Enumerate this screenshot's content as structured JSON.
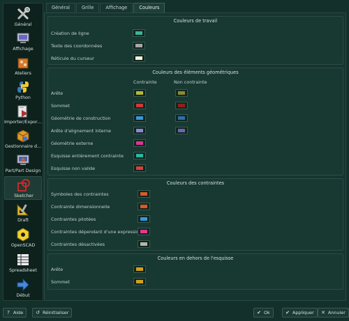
{
  "sidebar": {
    "items": [
      {
        "label": "Général",
        "icon": "tools-icon"
      },
      {
        "label": "Affichage",
        "icon": "monitor-icon"
      },
      {
        "label": "Ateliers",
        "icon": "workbench-icon"
      },
      {
        "label": "Python",
        "icon": "python-icon"
      },
      {
        "label": "Importer/Exporter",
        "icon": "import-export-icon"
      },
      {
        "label": "Gestionnaire d...",
        "icon": "addon-manager-icon"
      },
      {
        "label": "Part/Part Design",
        "icon": "part-design-icon"
      },
      {
        "label": "Sketcher",
        "icon": "sketcher-icon"
      },
      {
        "label": "Draft",
        "icon": "draft-icon"
      },
      {
        "label": "OpenSCAD",
        "icon": "openscad-icon"
      },
      {
        "label": "Spreadsheet",
        "icon": "spreadsheet-icon"
      },
      {
        "label": "Début",
        "icon": "start-arrow-icon"
      }
    ],
    "active": "Sketcher"
  },
  "tabs": [
    "Général",
    "Grille",
    "Affichage",
    "Couleurs"
  ],
  "active_tab": "Couleurs",
  "work_colors": {
    "title": "Couleurs de travail",
    "rows": [
      {
        "label": "Création de ligne",
        "color": "#3bb39a"
      },
      {
        "label": "Texte des coordonnées",
        "color": "#a8a8a8"
      },
      {
        "label": "Réticule du curseur",
        "color": "#f2f2dc"
      }
    ]
  },
  "geometry_colors": {
    "title": "Couleurs des éléments géométriques",
    "col_constrained": "Contrainte",
    "col_unconstrained": "Non contrainte",
    "rows": [
      {
        "label": "Arête",
        "color": "#b8b838",
        "color2": "#8a8a30"
      },
      {
        "label": "Sommet",
        "color": "#d03838",
        "color2": "#902020"
      },
      {
        "label": "Géométrie de construction",
        "color": "#3898d8",
        "color2": "#2a70a8"
      },
      {
        "label": "Arête d'alignement interne",
        "color": "#8888d8",
        "color2": "#6868b0"
      },
      {
        "label": "Géométrie externe",
        "color": "#d8388c",
        "color2": ""
      },
      {
        "label": "Esquisse entièrement contrainte",
        "color": "#2ab8a0",
        "color2": ""
      },
      {
        "label": "Esquisse non valide",
        "color": "#d84040",
        "color2": ""
      }
    ]
  },
  "constraint_colors": {
    "title": "Couleurs des contraintes",
    "rows": [
      {
        "label": "Symboles des contraintes",
        "color": "#d85a28"
      },
      {
        "label": "Contrainte dimensionnelle",
        "color": "#d85a28"
      },
      {
        "label": "Contraintes pilotées",
        "color": "#3898d8"
      },
      {
        "label": "Contraintes dépendant d'une expression",
        "color": "#e0388c"
      },
      {
        "label": "Contraintes désactivées",
        "color": "#b8b8a8"
      }
    ]
  },
  "outside_colors": {
    "title": "Couleurs en dehors de l'esquisse",
    "rows": [
      {
        "label": "Arête",
        "color": "#d0a020"
      },
      {
        "label": "Sommet",
        "color": "#d0a020"
      }
    ]
  },
  "buttons": {
    "help": "Aide",
    "reset": "Réinitialiser",
    "ok": "Ok",
    "apply": "Appliquer",
    "cancel": "Annuler"
  }
}
